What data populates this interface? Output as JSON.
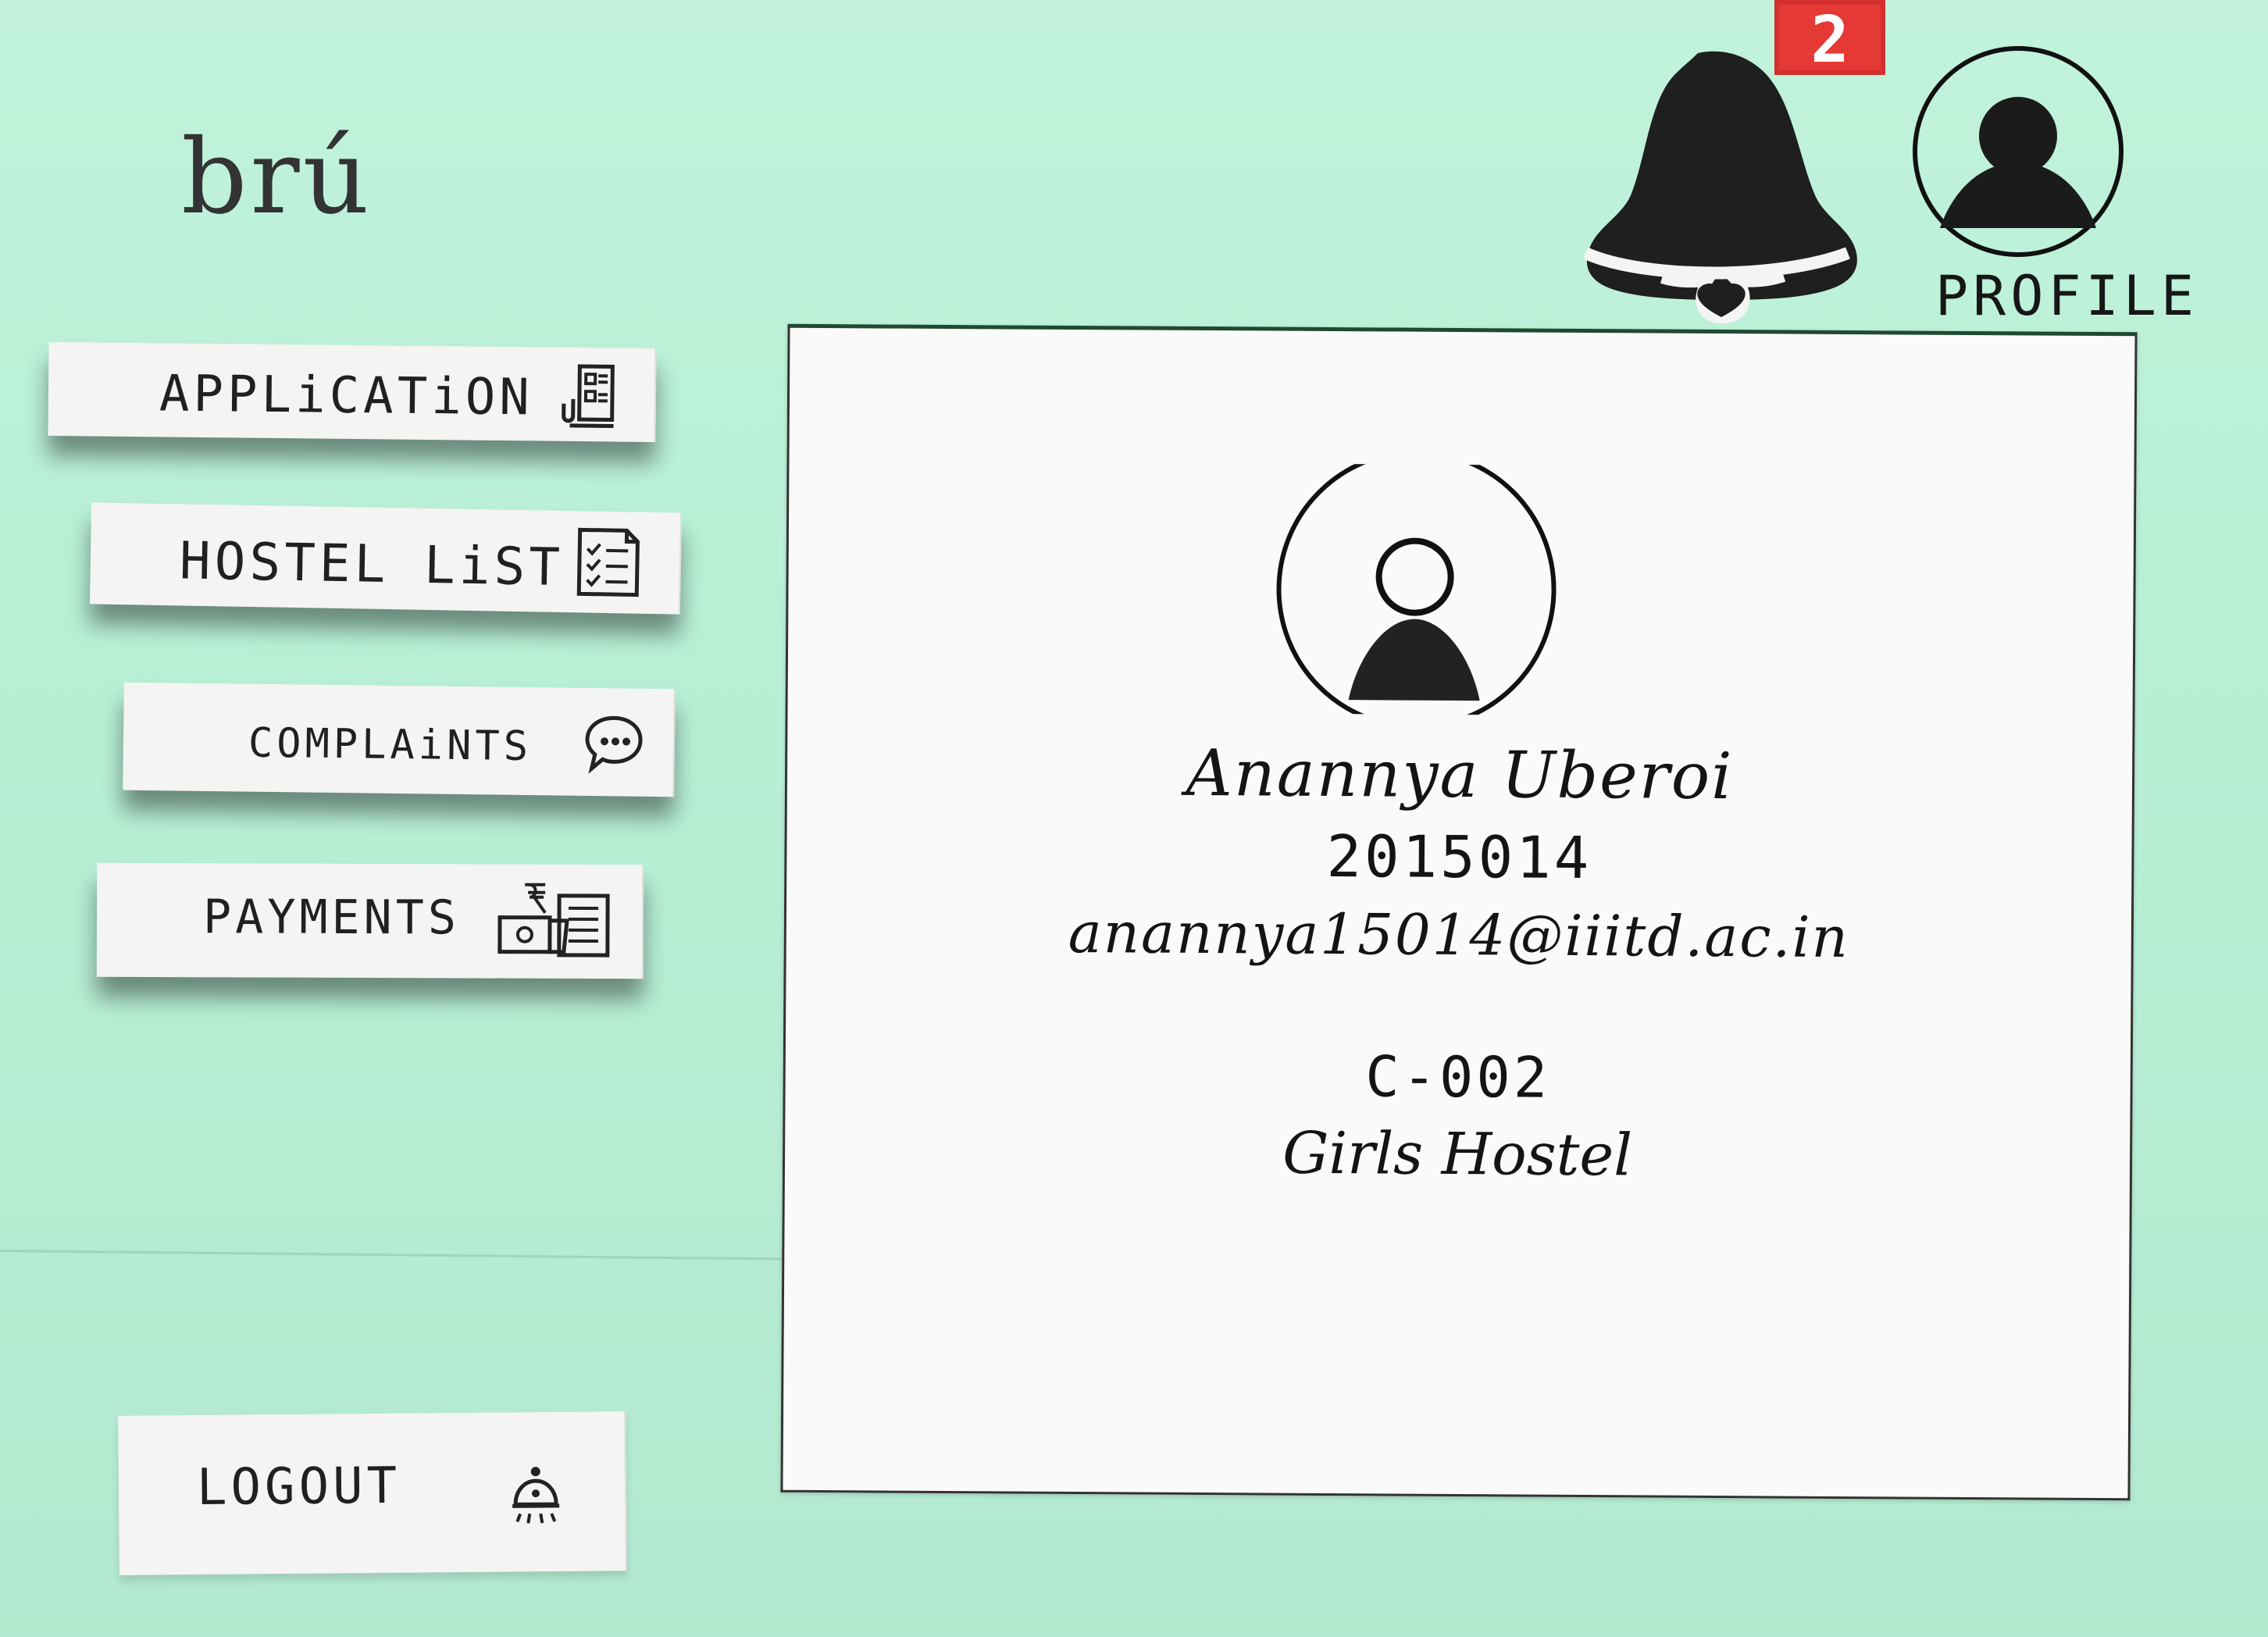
{
  "brand": {
    "name": "brú"
  },
  "nav": {
    "items": [
      {
        "label": "APPLiCATiON",
        "icon": "document-form-icon"
      },
      {
        "label": "HOSTEL LiST",
        "icon": "checklist-icon"
      },
      {
        "label": "COMPLAiNTS",
        "icon": "chat-bubble-icon"
      },
      {
        "label": "PAYMENTS",
        "icon": "payment-cash-icon"
      }
    ],
    "logout": {
      "label": "LOGOUT",
      "icon": "logout-icon"
    }
  },
  "header": {
    "notifications": {
      "count": "2",
      "icon": "bell-icon"
    },
    "profile": {
      "label": "PROFILE",
      "icon": "profile-avatar-icon"
    }
  },
  "profile_card": {
    "avatar_icon": "user-avatar-icon",
    "name": "Anannya Uberoi",
    "id": "2015014",
    "email": "anannya15014@iiitd.ac.in",
    "room": "C-002",
    "hostel": "Girls Hostel"
  }
}
